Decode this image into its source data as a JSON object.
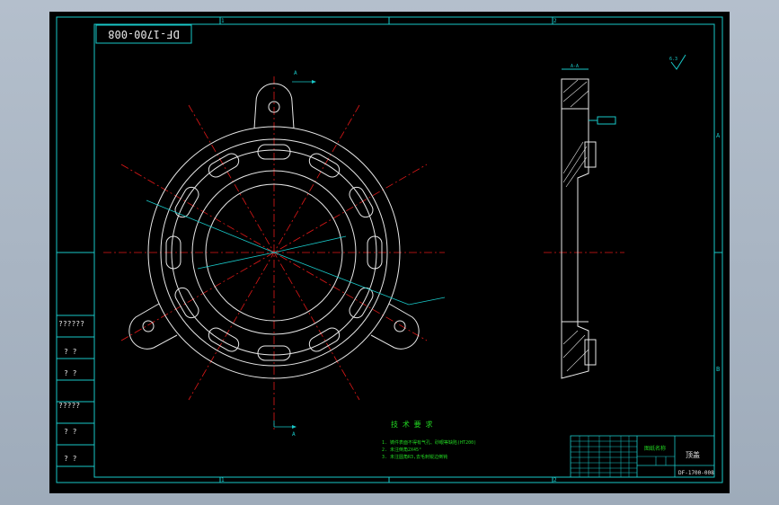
{
  "drawing": {
    "number": "DF-1700-008",
    "title_block_number": "DF-1700-008",
    "part_name": "顶盖",
    "company_mark": "图纸名称",
    "border_letters": {
      "right_top": "A",
      "right_bottom": "B"
    },
    "border_numbers": {
      "top_left": "1",
      "top_mid": "2",
      "bottom_left": "1",
      "bottom_mid": "2"
    }
  },
  "left_panel": {
    "rows": [
      "??????",
      "? ?",
      "? ?",
      "?????",
      "? ?",
      "? ?"
    ]
  },
  "tech_requirements": {
    "heading": "技 术 要 求",
    "items": [
      "1. 铸件表面不得有气孔、砂眼等缺陷(HT200)",
      "2. 未注倒角2X45°",
      "3. 未注圆角R3,去毛刺锐边倒钝"
    ]
  },
  "section_label": "A-A",
  "view_labels": {
    "top_arrow": "A",
    "bottom_arrow": "A"
  },
  "roughness_note": "6.3"
}
